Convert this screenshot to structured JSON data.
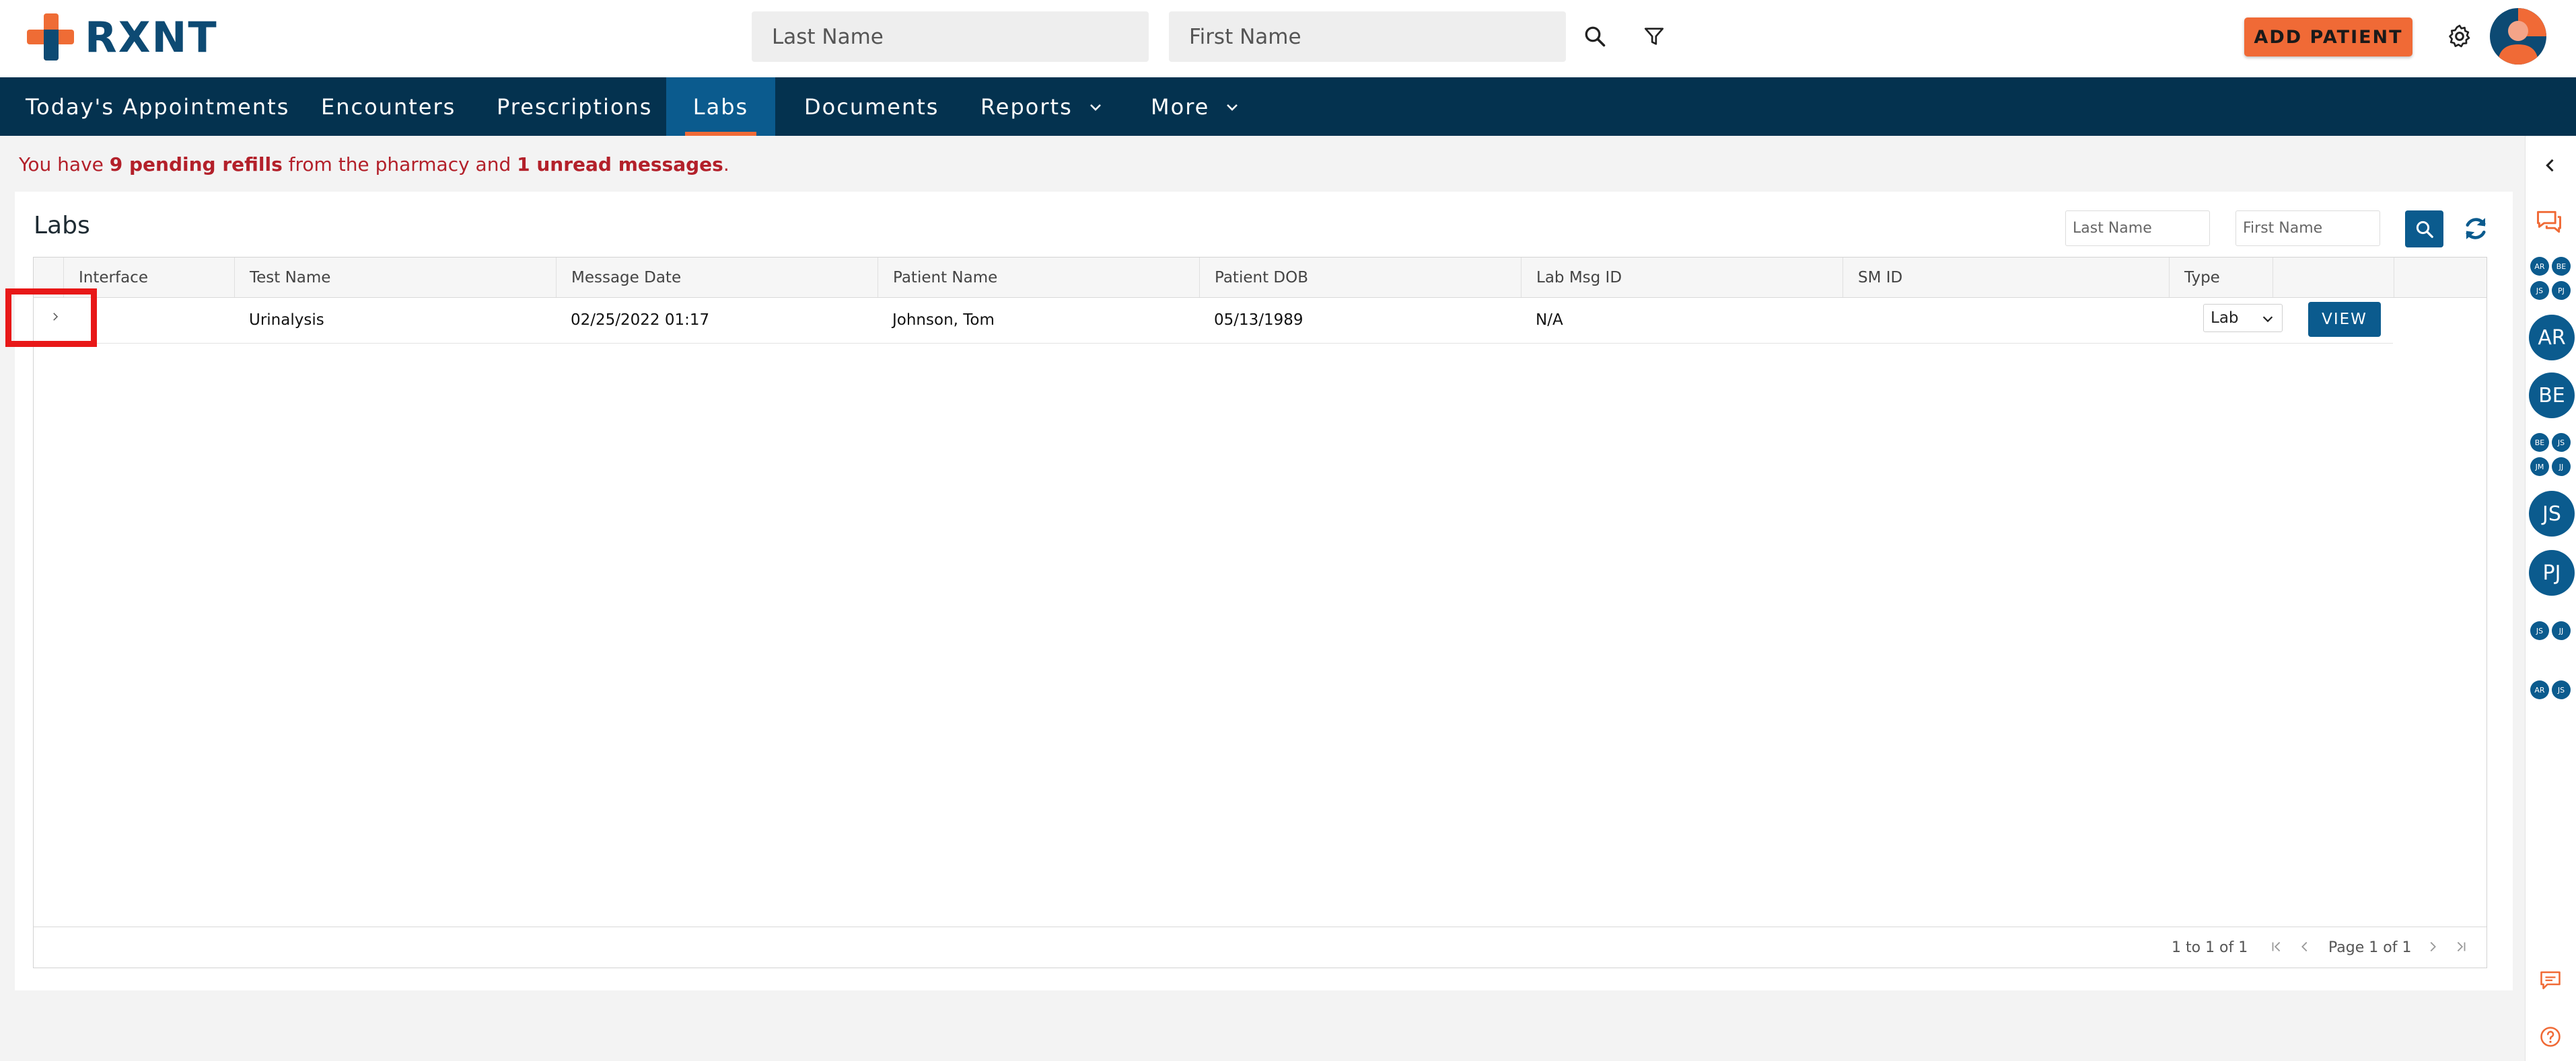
{
  "app": {
    "logo_text": "RXNT"
  },
  "header": {
    "last_name_placeholder": "Last Name",
    "first_name_placeholder": "First Name",
    "add_patient_label": "ADD PATIENT",
    "icons": [
      "search-icon",
      "filter-icon",
      "gear-icon",
      "avatar"
    ]
  },
  "nav": {
    "items": [
      {
        "label": "Today's Appointments"
      },
      {
        "label": "Encounters"
      },
      {
        "label": "Prescriptions"
      },
      {
        "label": "Labs",
        "active": true
      },
      {
        "label": "Documents"
      },
      {
        "label": "Reports",
        "has_dropdown": true
      },
      {
        "label": "More",
        "has_dropdown": true
      }
    ]
  },
  "alert": {
    "prefix": "You have ",
    "refills": "9 pending refills",
    "middle": " from the pharmacy and ",
    "unread": "1 unread messages",
    "suffix": "."
  },
  "labs": {
    "title": "Labs",
    "last_name_placeholder": "Last Name",
    "first_name_placeholder": "First Name",
    "columns": [
      "Interface",
      "Test Name",
      "Message Date",
      "Patient Name",
      "Patient DOB",
      "Lab Msg ID",
      "SM ID",
      "Type"
    ],
    "rows": [
      {
        "interface": "",
        "test_name": "Urinalysis",
        "message_date": "02/25/2022 01:17",
        "patient_name": "Johnson, Tom",
        "patient_dob": "05/13/1989",
        "lab_msg_id": "N/A",
        "sm_id": "",
        "type": "Lab",
        "action": "VIEW"
      }
    ],
    "footer": {
      "range": "1 to 1 of 1",
      "page": "Page 1 of 1"
    }
  },
  "right_rail": {
    "big_avatars": [
      "AR",
      "BE",
      "JS",
      "PJ"
    ],
    "group1": [
      "AR",
      "BE",
      "JS",
      "PJ"
    ],
    "group2": [
      "BE",
      "JS",
      "JM",
      "JJ"
    ],
    "group3": [
      "JS",
      "JJ"
    ],
    "group4": [
      "AR",
      "JS"
    ]
  },
  "colors": {
    "nav_bg": "#04324f",
    "nav_active": "#0b5b8e",
    "accent_orange": "#f06a36",
    "brand_blue": "#0d4a73",
    "alert_red": "#b3202a",
    "highlight_red": "#e81818"
  }
}
